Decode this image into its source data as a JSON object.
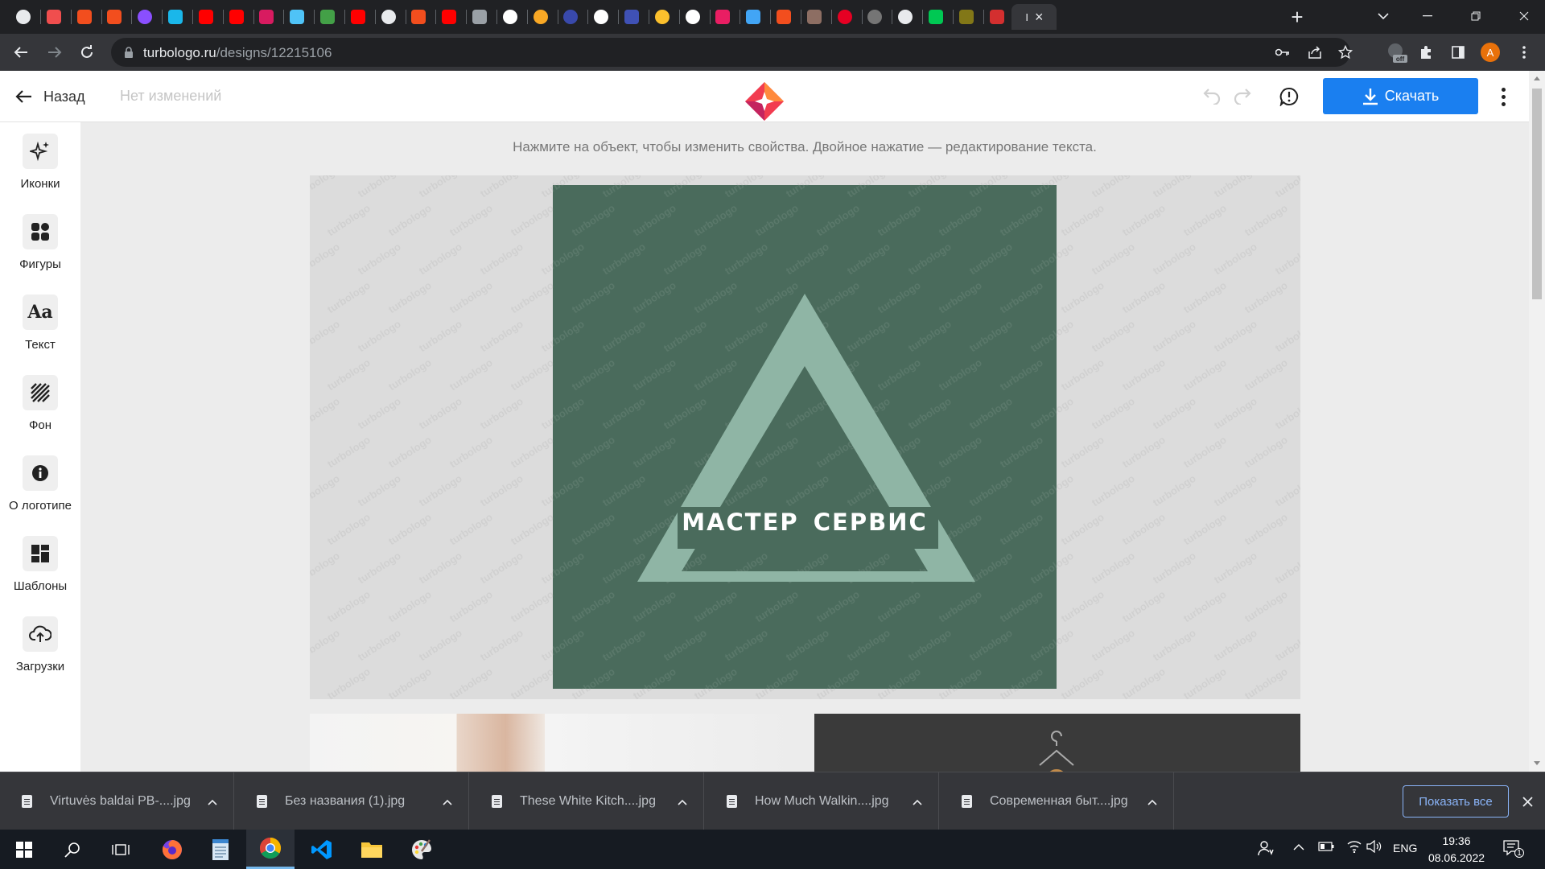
{
  "browser": {
    "url_host": "turbologo.ru",
    "url_path": "/designs/12215106",
    "profile_initial": "A",
    "extension_badge": "off",
    "tabs": [
      {
        "icon": "chrome-globe-icon",
        "color": "#e8eaed"
      },
      {
        "icon": "turbologo-icon",
        "color": "#f04e4e"
      },
      {
        "icon": "figma-icon",
        "color": "#f24e1e"
      },
      {
        "icon": "figma-icon",
        "color": "#f24e1e"
      },
      {
        "icon": "u-circle-icon",
        "color": "#8a4fff"
      },
      {
        "icon": "vimeo-icon",
        "color": "#1ab7ea"
      },
      {
        "icon": "youtube-icon",
        "color": "#ff0000"
      },
      {
        "icon": "youtube-icon",
        "color": "#ff0000"
      },
      {
        "icon": "h-icon",
        "color": "#d81b60"
      },
      {
        "icon": "frame-icon",
        "color": "#4fc3f7"
      },
      {
        "icon": "h-icon",
        "color": "#43a047"
      },
      {
        "icon": "youtube-icon",
        "color": "#ff0000"
      },
      {
        "icon": "chrome-globe-icon",
        "color": "#e8eaed"
      },
      {
        "icon": "figma-icon",
        "color": "#f24e1e"
      },
      {
        "icon": "youtube-icon",
        "color": "#ff0000"
      },
      {
        "icon": "swoosh-icon",
        "color": "#9aa0a6"
      },
      {
        "icon": "google-icon",
        "color": "#ffffff"
      },
      {
        "icon": "orange-circle-icon",
        "color": "#f9a825"
      },
      {
        "icon": "loop-icon",
        "color": "#3949ab"
      },
      {
        "icon": "google-icon",
        "color": "#ffffff"
      },
      {
        "icon": "app-blue-icon",
        "color": "#3f51b5"
      },
      {
        "icon": "play-yellow-icon",
        "color": "#fbc02d"
      },
      {
        "icon": "google-icon",
        "color": "#ffffff"
      },
      {
        "icon": "feather-icon",
        "color": "#e91e63"
      },
      {
        "icon": "calendar-icon",
        "color": "#42a5f5"
      },
      {
        "icon": "figma-icon",
        "color": "#f24e1e"
      },
      {
        "icon": "image-icon",
        "color": "#8d6e63"
      },
      {
        "icon": "pinterest-icon",
        "color": "#e60023"
      },
      {
        "icon": "drop-icon",
        "color": "#757575"
      },
      {
        "icon": "chrome-globe-icon",
        "color": "#e8eaed"
      },
      {
        "icon": "monster-icon",
        "color": "#00c853"
      },
      {
        "icon": "tree-icon",
        "color": "#827717"
      },
      {
        "icon": "red-square-icon",
        "color": "#d32f2f"
      }
    ],
    "active_tab_label": "I"
  },
  "app": {
    "back_label": "Назад",
    "status": "Нет изменений",
    "download_label": "Скачать",
    "accent": "#1a7ff0",
    "sidebar": [
      {
        "label": "Иконки",
        "icon": "sparkles-icon"
      },
      {
        "label": "Фигуры",
        "icon": "shapes-icon"
      },
      {
        "label": "Текст",
        "icon": "text-aa-icon"
      },
      {
        "label": "Фон",
        "icon": "stripes-icon"
      },
      {
        "label": "О логотипе",
        "icon": "info-icon"
      },
      {
        "label": "Шаблоны",
        "icon": "templates-icon"
      },
      {
        "label": "Загрузки",
        "icon": "cloud-upload-icon"
      }
    ],
    "hint": "Нажмите на объект, чтобы изменить свойства. Двойное нажатие — редактирование текста.",
    "logo": {
      "text": "МАСТЕР СЕРВИС",
      "background": "#4a6b5c",
      "shape_color": "#8fb5a5",
      "watermark": "turbologo"
    }
  },
  "downloads": {
    "items": [
      {
        "name": "Virtuvės baldai PB-....jpg"
      },
      {
        "name": "Без названия (1).jpg"
      },
      {
        "name": "These White Kitch....jpg"
      },
      {
        "name": "How Much Walkin....jpg"
      },
      {
        "name": "Современная быт....jpg"
      }
    ],
    "show_all_label": "Показать все"
  },
  "taskbar": {
    "lang": "ENG",
    "time": "19:36",
    "date": "08.06.2022",
    "notification_count": "1"
  }
}
